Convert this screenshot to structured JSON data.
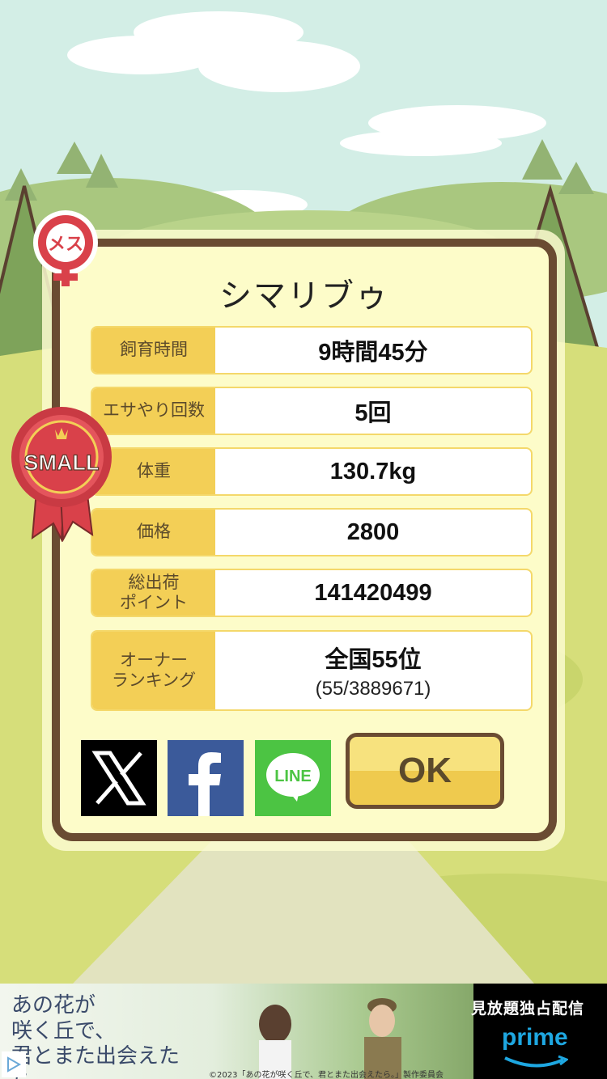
{
  "dialog": {
    "title": "シマリブゥ",
    "gender_badge": "メス",
    "size_badge": "SMALL",
    "stats": [
      {
        "label": "飼育時間",
        "value": "9時間45分"
      },
      {
        "label": "エサやり回数",
        "value": "5回"
      },
      {
        "label": "体重",
        "value": "130.7kg"
      },
      {
        "label": "価格",
        "value": "2800"
      },
      {
        "label": "総出荷\nポイント",
        "value": "141420499"
      },
      {
        "label": "オーナー\nランキング",
        "value": "全国55位",
        "sub": "(55/3889671)"
      }
    ],
    "share": {
      "x_icon": "x-logo-icon",
      "facebook_icon": "facebook-logo-icon",
      "line_label": "LINE"
    },
    "ok_label": "OK"
  },
  "ad": {
    "title": "あの花が\n咲く丘で、\n君とまた出会えたら。",
    "right_label": "見放題独占配信",
    "brand": "prime",
    "copyright": "©2023「あの花が咲く丘で、君とまた出会えたら。」製作委員会"
  },
  "colors": {
    "sky": "#d3eee6",
    "frame_brown": "#6a4b32",
    "label_yellow": "#f3cf56",
    "panel_cream": "#fdfcc9",
    "badge_red": "#d9414a"
  }
}
